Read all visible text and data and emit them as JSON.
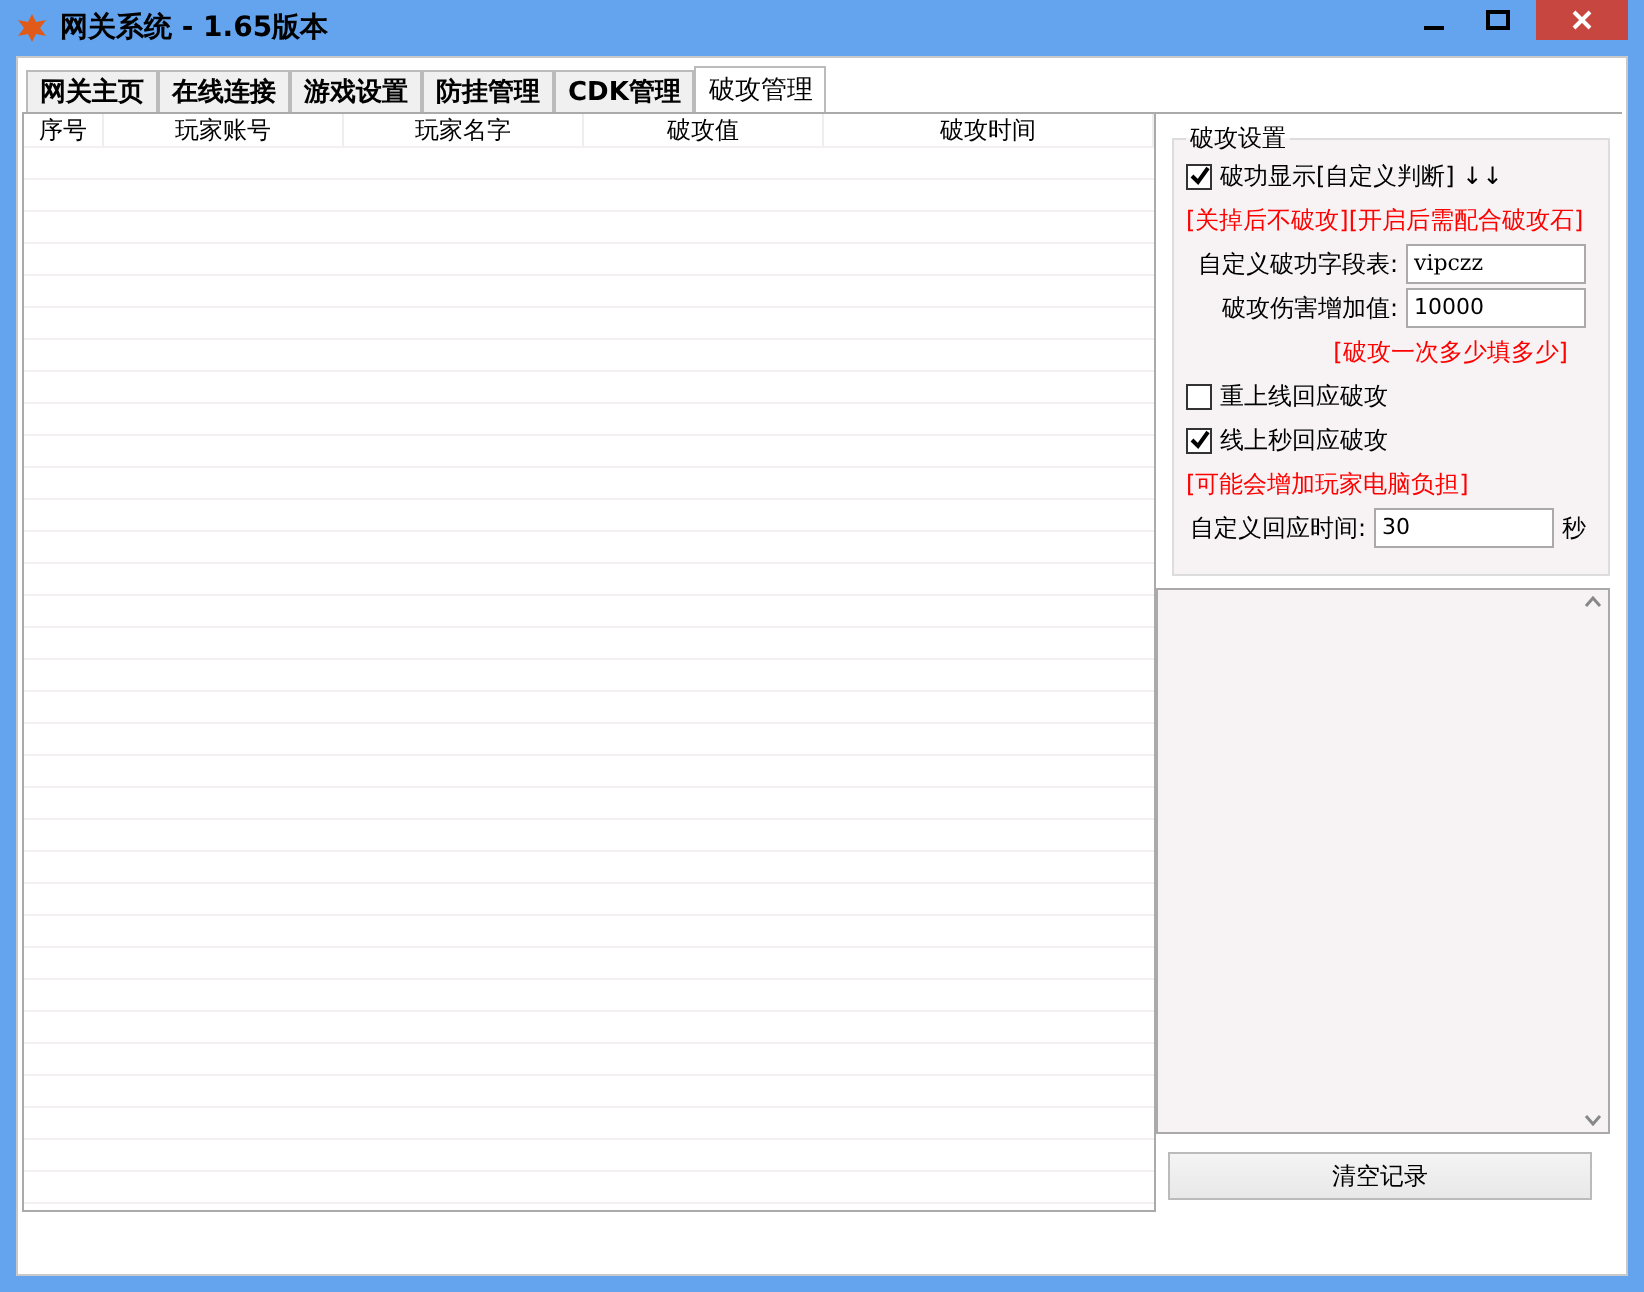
{
  "window": {
    "title": "网关系统 - 1.65版本"
  },
  "tabs": [
    {
      "label": "网关主页",
      "selected": false
    },
    {
      "label": "在线连接",
      "selected": false
    },
    {
      "label": "游戏设置",
      "selected": false
    },
    {
      "label": "防挂管理",
      "selected": false
    },
    {
      "label": "CDK管理",
      "selected": false
    },
    {
      "label": "破攻管理",
      "selected": true
    }
  ],
  "table": {
    "columns": [
      "序号",
      "玩家账号",
      "玩家名字",
      "破攻值",
      "破攻时间"
    ]
  },
  "settings": {
    "title": "破攻设置",
    "items": [
      {
        "kind": "check",
        "label": "破功显示[自定义判断] ↓↓",
        "checked": true
      },
      {
        "kind": "note",
        "text": "[关掉后不破攻][开启后需配合破攻石]"
      },
      {
        "kind": "field",
        "label": "自定义破功字段表:",
        "value": "vipczz",
        "mono": true
      },
      {
        "kind": "field",
        "label": "破攻伤害增加值:",
        "value": "10000",
        "mono": false
      },
      {
        "kind": "note",
        "text": "[破攻一次多少填多少]",
        "align_right": true
      },
      {
        "kind": "check",
        "label": "重上线回应破攻",
        "checked": false
      },
      {
        "kind": "check",
        "label": "线上秒回应破攻",
        "checked": true
      },
      {
        "kind": "note",
        "text": "[可能会增加玩家电脑负担]"
      },
      {
        "kind": "field",
        "label": "自定义回应时间:",
        "value": "30",
        "unit": "秒"
      }
    ]
  },
  "clear_button": "清空记录"
}
